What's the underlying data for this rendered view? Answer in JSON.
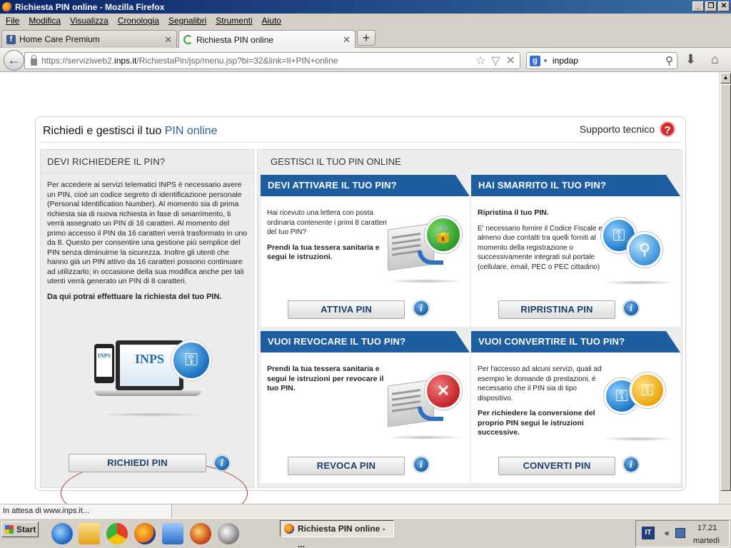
{
  "window": {
    "title": "Richiesta PIN online - Mozilla Firefox"
  },
  "menu": [
    "File",
    "Modifica",
    "Visualizza",
    "Cronologia",
    "Segnalibri",
    "Strumenti",
    "Aiuto"
  ],
  "tabs": [
    {
      "label": "Home Care Premium"
    },
    {
      "label": "Richiesta PIN online"
    }
  ],
  "nav": {
    "url_prefix": "https://serviziweb2.",
    "url_domain": "inps.it",
    "url_rest": "/RichiestaPin/jsp/menu.jsp?bi=32&link=Il+PIN+online",
    "search_value": "inpdap"
  },
  "page": {
    "title_prefix": "Richiedi e gestisci il tuo",
    "title_highlight": "PIN online",
    "support": "Supporto tecnico",
    "left": {
      "heading": "DEVI RICHIEDERE IL PIN?",
      "body": "Per accedere ai servizi telematici INPS è necessario avere un PIN, cioè un codice segreto di identificazione personale (Personal Identification Number). Al momento sia di prima richiesta sia di nuova richiesta in fase di smarrimento, ti verrà assegnato un PIN di 16 caratteri. Al momento del primo accesso il PIN da 16 caratteri verrà trasformato in uno da 8. Questo per consentire una gestione più semplice del PIN senza diminuirne la sicurezza. Inoltre gli utenti che hanno già un PIN attivo da 16 caratteri possono continuare ad utilizzarlo; in occasione della sua modifica anche per tali utenti verrà generato un PIN di 8 caratteri.",
      "bold": "Da qui potrai effettuare la richiesta del tuo PIN.",
      "logo_text": "INPS",
      "button": "RICHIEDI PIN"
    },
    "right": {
      "heading": "GESTISCI IL TUO PIN ONLINE",
      "cards": [
        {
          "title": "DEVI ATTIVARE IL TUO PIN?",
          "text": "Hai ricevuto una lettera con posta ordinaria contenente i primi 8 caratteri del tuo PIN?",
          "bold": "Prendi la tua tessera sanitaria e segui le istruzioni.",
          "button": "ATTIVA PIN"
        },
        {
          "title": "HAI SMARRITO IL TUO PIN?",
          "bold": "Ripristina il tuo PIN.",
          "text": "E' necessario fornire il Codice Fiscale e almeno due contatti tra quelli forniti al momento della registrazione o successivamente integrati sul portale (cellulare, email, PEC o PEC cittadino)",
          "button": "RIPRISTINA PIN"
        },
        {
          "title": "VUOI REVOCARE IL TUO PIN?",
          "bold": "Prendi la tua tessera sanitaria e segui le istruzioni per revocare il tuo PIN.",
          "button": "REVOCA PIN"
        },
        {
          "title": "VUOI CONVERTIRE IL TUO PIN?",
          "text": "Per l'accesso ad alcuni servizi, quali ad esempio le domande di prestazioni, è necessario che il PIN sia di tipo dispositivo.",
          "bold": "Per richiedere la conversione del proprio PIN segui le istruzioni successive.",
          "button": "CONVERTI PIN"
        }
      ]
    }
  },
  "status": {
    "text": "In attesa di www.inps.it..."
  },
  "taskbar": {
    "start": "Start",
    "task": "Richiesta PIN online - ...",
    "lang": "IT",
    "time": "17.21",
    "day": "martedì"
  },
  "colors": {
    "accent_blue": "#1d5ea0",
    "help_red": "#d32a2a",
    "oval_red": "#c43232"
  }
}
